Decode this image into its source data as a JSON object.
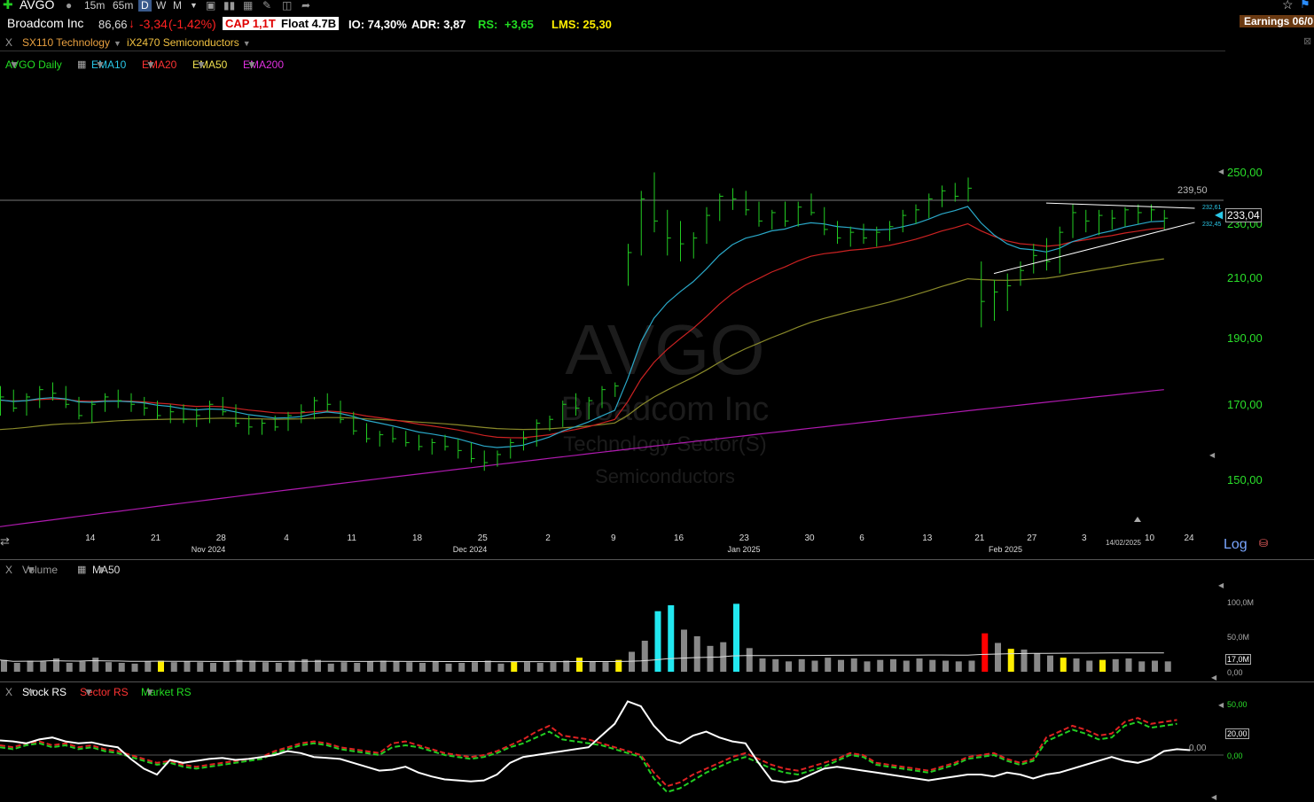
{
  "toolbar": {
    "symbol": "AVGO",
    "tf_15m": "15m",
    "tf_65m": "65m",
    "tf_d": "D",
    "tf_w": "W",
    "tf_m": "M"
  },
  "header": {
    "company": "Broadcom Inc",
    "price": "86,66",
    "change": "-3,34",
    "change_pct": "(-1,42%)",
    "cap": "CAP 1,1T",
    "float": "Float 4.7B",
    "io": "IO: 74,30%",
    "adr": "ADR: 3,87",
    "rs_label": "RS:",
    "rs_value": "+3,65",
    "lms": "LMS: 25,30",
    "earnings": "Earnings 06/0",
    "close_x": "X"
  },
  "groups": {
    "sector": "SX110 Technology",
    "industry": "iX2470 Semiconductors"
  },
  "indicators": {
    "main": "AVGO Daily",
    "ema10": "EMA10",
    "ema20": "EMA20",
    "ema50": "EMA50",
    "ema200": "EMA200"
  },
  "watermark": {
    "symbol": "AVGO",
    "name": "Broadcom Inc",
    "sector": "Technology Sector(S)",
    "industry": "Semiconductors"
  },
  "price_axis": {
    "ticks": [
      "250,00",
      "230,00",
      "210,00",
      "190,00",
      "170,00",
      "150,00"
    ],
    "resistance": "239,50",
    "last": "233,04",
    "upper_small": "232,61",
    "lower_small": "232,45",
    "scale": "Log"
  },
  "date_axis": {
    "days": [
      "14",
      "21",
      "28",
      "4",
      "11",
      "18",
      "25",
      "2",
      "9",
      "16",
      "23",
      "30",
      "6",
      "13",
      "21",
      "27",
      "3",
      "10",
      "24"
    ],
    "months": [
      "Nov 2024",
      "Dec 2024",
      "Jan 2025",
      "Feb 2025"
    ],
    "current": "14/02/2025"
  },
  "volume_panel": {
    "label": "Volume",
    "ma": "MA50",
    "ticks": [
      "100,0M",
      "50,0M",
      "0,00"
    ],
    "last": "17,0M"
  },
  "rs_panel": {
    "stock": "Stock RS",
    "sector": "Sector RS",
    "market": "Market RS",
    "ticks": [
      "50,00",
      "0,00"
    ],
    "zero": "0,00",
    "last": "20,00"
  },
  "colors": {
    "up": "#22cc22",
    "down": "#ff2222",
    "ema10": "#2aa8c8",
    "ema20": "#cc2222",
    "ema50": "#8a8a2a",
    "ema200": "#b01ab0",
    "volume_normal": "#888888",
    "volume_high": "#22e8f0",
    "volume_yellow": "#ffee00",
    "volume_red": "#ff0000"
  },
  "chart_data": [
    {
      "type": "bar",
      "title": "AVGO Daily",
      "ylim": [
        140,
        255
      ],
      "scale": "log",
      "x": [
        "2024-10-07",
        "2024-10-08",
        "2024-10-09",
        "2024-10-10",
        "2024-10-11",
        "2024-10-14",
        "2024-10-15",
        "2024-10-16",
        "2024-10-17",
        "2024-10-18",
        "2024-10-21",
        "2024-10-22",
        "2024-10-23",
        "2024-10-24",
        "2024-10-25",
        "2024-10-28",
        "2024-10-29",
        "2024-10-30",
        "2024-10-31",
        "2024-11-01",
        "2024-11-04",
        "2024-11-05",
        "2024-11-06",
        "2024-11-07",
        "2024-11-08",
        "2024-11-11",
        "2024-11-12",
        "2024-11-13",
        "2024-11-14",
        "2024-11-15",
        "2024-11-18",
        "2024-11-19",
        "2024-11-20",
        "2024-11-21",
        "2024-11-22",
        "2024-11-25",
        "2024-11-26",
        "2024-11-27",
        "2024-11-29",
        "2024-12-02",
        "2024-12-03",
        "2024-12-04",
        "2024-12-05",
        "2024-12-06",
        "2024-12-09",
        "2024-12-10",
        "2024-12-11",
        "2024-12-12",
        "2024-12-13",
        "2024-12-16",
        "2024-12-17",
        "2024-12-18",
        "2024-12-19",
        "2024-12-20",
        "2024-12-23",
        "2024-12-24",
        "2024-12-26",
        "2024-12-27",
        "2024-12-30",
        "2024-12-31",
        "2025-01-02",
        "2025-01-03",
        "2025-01-06",
        "2025-01-07",
        "2025-01-08",
        "2025-01-10",
        "2025-01-13",
        "2025-01-14",
        "2025-01-15",
        "2025-01-16",
        "2025-01-17",
        "2025-01-21",
        "2025-01-22",
        "2025-01-23",
        "2025-01-24",
        "2025-01-27",
        "2025-01-28",
        "2025-01-29",
        "2025-01-30",
        "2025-01-31",
        "2025-02-03",
        "2025-02-04",
        "2025-02-05",
        "2025-02-06",
        "2025-02-07",
        "2025-02-10",
        "2025-02-11",
        "2025-02-12",
        "2025-02-13",
        "2025-02-14"
      ],
      "ohlc": [
        [
          176,
          180,
          172,
          177
        ],
        [
          177,
          179,
          173,
          174
        ],
        [
          174,
          178,
          172,
          177
        ],
        [
          177,
          180,
          174,
          179
        ],
        [
          179,
          181,
          176,
          178
        ],
        [
          178,
          180,
          174,
          175
        ],
        [
          175,
          177,
          171,
          172
        ],
        [
          172,
          176,
          170,
          175
        ],
        [
          175,
          178,
          173,
          177
        ],
        [
          177,
          179,
          174,
          176
        ],
        [
          176,
          178,
          173,
          175
        ],
        [
          175,
          177,
          172,
          174
        ],
        [
          174,
          176,
          171,
          172
        ],
        [
          172,
          175,
          170,
          173
        ],
        [
          173,
          175,
          170,
          171
        ],
        [
          171,
          174,
          169,
          172
        ],
        [
          172,
          176,
          170,
          175
        ],
        [
          175,
          177,
          172,
          173
        ],
        [
          173,
          175,
          169,
          170
        ],
        [
          170,
          172,
          167,
          169
        ],
        [
          169,
          171,
          167,
          170
        ],
        [
          170,
          172,
          168,
          169
        ],
        [
          169,
          173,
          168,
          172
        ],
        [
          172,
          175,
          170,
          173
        ],
        [
          173,
          177,
          171,
          176
        ],
        [
          176,
          178,
          173,
          175
        ],
        [
          175,
          176,
          170,
          171
        ],
        [
          171,
          173,
          167,
          168
        ],
        [
          168,
          170,
          165,
          166
        ],
        [
          166,
          168,
          164,
          167
        ],
        [
          167,
          169,
          165,
          166
        ],
        [
          166,
          168,
          164,
          165
        ],
        [
          165,
          167,
          163,
          164
        ],
        [
          164,
          166,
          162,
          165
        ],
        [
          165,
          167,
          163,
          164
        ],
        [
          164,
          166,
          161,
          163
        ],
        [
          163,
          165,
          160,
          161
        ],
        [
          161,
          163,
          158,
          160
        ],
        [
          160,
          163,
          159,
          162
        ],
        [
          162,
          166,
          161,
          165
        ],
        [
          165,
          168,
          163,
          166
        ],
        [
          166,
          171,
          164,
          170
        ],
        [
          170,
          172,
          168,
          171
        ],
        [
          171,
          176,
          169,
          175
        ],
        [
          175,
          178,
          172,
          174
        ],
        [
          174,
          177,
          171,
          176
        ],
        [
          176,
          180,
          174,
          179
        ],
        [
          179,
          181,
          177,
          180
        ],
        [
          210,
          224,
          210,
          221
        ],
        [
          221,
          243,
          220,
          240
        ],
        [
          240,
          250,
          228,
          232
        ],
        [
          232,
          236,
          220,
          226
        ],
        [
          226,
          232,
          218,
          224
        ],
        [
          224,
          228,
          219,
          226
        ],
        [
          226,
          237,
          224,
          234
        ],
        [
          234,
          242,
          232,
          241
        ],
        [
          241,
          244,
          236,
          240
        ],
        [
          240,
          243,
          234,
          236
        ],
        [
          236,
          239,
          230,
          232
        ],
        [
          232,
          236,
          229,
          235
        ],
        [
          235,
          239,
          230,
          232
        ],
        [
          232,
          239,
          230,
          237
        ],
        [
          237,
          242,
          234,
          235
        ],
        [
          235,
          237,
          227,
          229
        ],
        [
          229,
          232,
          224,
          226
        ],
        [
          226,
          230,
          223,
          228
        ],
        [
          228,
          231,
          224,
          226
        ],
        [
          226,
          230,
          223,
          228
        ],
        [
          228,
          232,
          225,
          230
        ],
        [
          230,
          236,
          228,
          234
        ],
        [
          234,
          238,
          231,
          236
        ],
        [
          236,
          242,
          233,
          240
        ],
        [
          240,
          245,
          237,
          243
        ],
        [
          243,
          246,
          239,
          241
        ],
        [
          241,
          248,
          239,
          244
        ],
        [
          210,
          218,
          197,
          205
        ],
        [
          205,
          212,
          199,
          208
        ],
        [
          208,
          214,
          202,
          210
        ],
        [
          213,
          218,
          210,
          215
        ],
        [
          215,
          224,
          214,
          220
        ],
        [
          220,
          226,
          215,
          218
        ],
        [
          218,
          230,
          214,
          228
        ],
        [
          228,
          238,
          226,
          235
        ],
        [
          235,
          236,
          228,
          232
        ],
        [
          232,
          236,
          227,
          234
        ],
        [
          234,
          236,
          229,
          233
        ],
        [
          233,
          237,
          230,
          236
        ],
        [
          236,
          238,
          231,
          235
        ],
        [
          235,
          238,
          232,
          236
        ],
        [
          233,
          236,
          229,
          233
        ]
      ],
      "ema10_end": 232.6,
      "ema20_end": 229.0,
      "ema50_end": 219.0,
      "ema200_end": 179.0
    },
    {
      "type": "bar",
      "title": "Volume",
      "ylim": [
        0,
        120
      ],
      "values": [
        16,
        12,
        15,
        14,
        18,
        12,
        14,
        19,
        13,
        12,
        11,
        14,
        15,
        13,
        14,
        13,
        12,
        14,
        16,
        15,
        13,
        12,
        15,
        17,
        16,
        11,
        13,
        12,
        14,
        15,
        14,
        13,
        12,
        14,
        11,
        12,
        13,
        15,
        11,
        14,
        13,
        12,
        13,
        15,
        19,
        14,
        13,
        16,
        27,
        42,
        82,
        90,
        57,
        48,
        35,
        40,
        92,
        32,
        18,
        17,
        14,
        17,
        15,
        19,
        16,
        18,
        14,
        16,
        17,
        15,
        18,
        16,
        15,
        14,
        15,
        52,
        39,
        31,
        30,
        25,
        22,
        19,
        18,
        15,
        16,
        17,
        18,
        14,
        15,
        14
      ],
      "ma50_end": 28
    },
    {
      "type": "line",
      "title": "Stock RS",
      "series": [
        {
          "name": "Stock RS",
          "values": [
            15,
            14,
            12,
            16,
            18,
            14,
            12,
            13,
            10,
            8,
            -4,
            -14,
            -20,
            -5,
            -8,
            -6,
            -4,
            -3,
            -5,
            -4,
            -2,
            0,
            4,
            2,
            -2,
            -3,
            -4,
            -8,
            -12,
            -16,
            -15,
            -12,
            -18,
            -22,
            -25,
            -26,
            -27,
            -26,
            -20,
            -8,
            -2,
            0,
            2,
            4,
            6,
            8,
            20,
            32,
            55,
            50,
            30,
            16,
            12,
            20,
            24,
            18,
            14,
            12,
            -8,
            -26,
            -28,
            -26,
            -20,
            -14,
            -12,
            -14,
            -16,
            -18,
            -20,
            -22,
            -24,
            -26,
            -24,
            -22,
            -20,
            -20,
            -22,
            -18,
            -20,
            -24,
            -20,
            -18,
            -14,
            -10,
            -6,
            -2,
            -6,
            -8,
            -4,
            4,
            6,
            5
          ]
        },
        {
          "name": "Sector RS",
          "values": [
            10,
            8,
            12,
            14,
            10,
            12,
            8,
            10,
            6,
            4,
            0,
            -4,
            -8,
            -6,
            -10,
            -12,
            -10,
            -8,
            -6,
            -4,
            -2,
            4,
            8,
            12,
            14,
            12,
            8,
            6,
            4,
            2,
            12,
            14,
            10,
            6,
            2,
            0,
            -2,
            0,
            4,
            10,
            16,
            24,
            30,
            20,
            18,
            16,
            12,
            8,
            4,
            0,
            -18,
            -32,
            -28,
            -20,
            -14,
            -8,
            -2,
            2,
            -4,
            -10,
            -14,
            -16,
            -12,
            -8,
            -4,
            2,
            0,
            -8,
            -10,
            -12,
            -14,
            -16,
            -12,
            -8,
            -2,
            0,
            2,
            -4,
            -8,
            -4,
            18,
            24,
            30,
            26,
            20,
            22,
            34,
            38,
            32,
            34,
            36
          ]
        },
        {
          "name": "Market RS",
          "values": [
            8,
            6,
            10,
            12,
            8,
            10,
            6,
            8,
            4,
            2,
            -2,
            -6,
            -10,
            -8,
            -12,
            -14,
            -12,
            -10,
            -8,
            -6,
            -4,
            2,
            6,
            10,
            12,
            10,
            6,
            4,
            2,
            0,
            8,
            10,
            8,
            4,
            0,
            -2,
            -4,
            -2,
            2,
            8,
            12,
            18,
            24,
            16,
            14,
            12,
            10,
            6,
            2,
            -2,
            -24,
            -38,
            -34,
            -26,
            -18,
            -12,
            -6,
            -2,
            -8,
            -14,
            -18,
            -20,
            -16,
            -12,
            -6,
            0,
            -2,
            -10,
            -12,
            -14,
            -16,
            -18,
            -14,
            -10,
            -4,
            -2,
            0,
            -6,
            -10,
            -6,
            14,
            20,
            26,
            22,
            16,
            18,
            30,
            34,
            28,
            30,
            32
          ]
        }
      ]
    }
  ]
}
